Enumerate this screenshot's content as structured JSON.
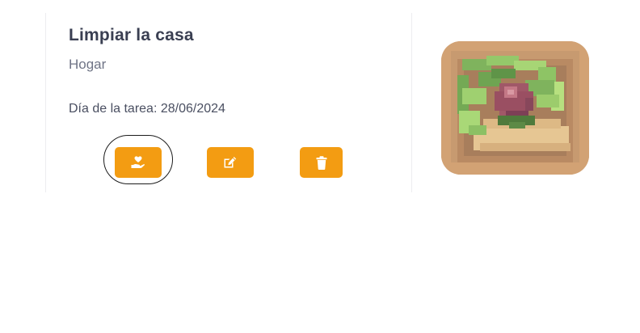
{
  "task": {
    "title": "Limpiar la casa",
    "category": "Hogar",
    "date_text": "Día de la tarea: 28/06/2024"
  },
  "actions": [
    {
      "name": "take-task",
      "icon": "hand-holding-heart-icon",
      "focused": true
    },
    {
      "name": "edit-task",
      "icon": "edit-icon",
      "focused": false
    },
    {
      "name": "delete-task",
      "icon": "trash-icon",
      "focused": false
    }
  ],
  "colors": {
    "accent": "#f39c12",
    "title": "#3a3f52",
    "muted": "#6f7486",
    "thumb_bg": "#d1a276"
  }
}
